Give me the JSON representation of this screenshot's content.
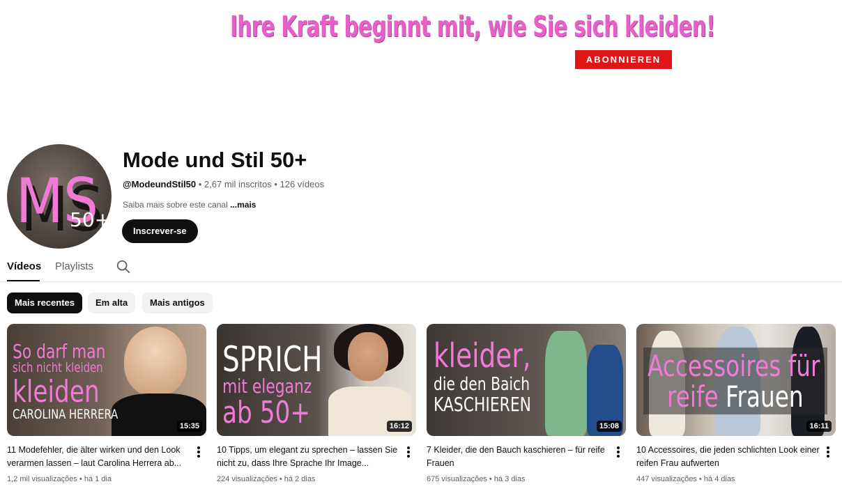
{
  "banner": {
    "slogan": "Ihre Kraft beginnt mit, wie Sie sich kleiden!",
    "subscribe_label": "ABONNIEREN"
  },
  "channel": {
    "avatar_text_main": "MS",
    "avatar_text_sub": "50+",
    "name": "Mode und Stil 50+",
    "handle": "@ModeundStil50",
    "meta_rest": " • 2,67 mil inscritos • 126 vídeos",
    "about_text": "Saiba mais sobre este canal ",
    "about_more": "...mais",
    "subscribe_button": "Inscrever-se"
  },
  "tabs": [
    {
      "label": "Vídeos",
      "active": true
    },
    {
      "label": "Playlists",
      "active": false
    }
  ],
  "tab_search_icon": "search-icon",
  "chips": [
    {
      "label": "Mais recentes",
      "active": true
    },
    {
      "label": "Em alta",
      "active": false
    },
    {
      "label": "Mais antigos",
      "active": false
    }
  ],
  "videos": [
    {
      "thumb_lines": [
        "So darf man",
        "sich nicht kleiden",
        "kleiden",
        "CAROLINA HERRERA"
      ],
      "duration": "15:35",
      "title": "11 Modefehler, die älter wirken und den Look verarmen lassen – laut Carolina Herrera ab...",
      "meta": "1,2 mil visualizações • há 1 dia"
    },
    {
      "thumb_lines": [
        "SPRICH",
        "mit eleganz",
        "ab 50+"
      ],
      "duration": "16:12",
      "title": "10 Tipps, um elegant zu sprechen – lassen Sie nicht zu, dass Ihre Sprache Ihr Image...",
      "meta": "224 visualizações • há 2 dias"
    },
    {
      "thumb_lines": [
        "kleider,",
        "die den Baich",
        "KASCHIEREN"
      ],
      "duration": "15:08",
      "title": "7 Kleider, die den Bauch kaschieren – für reife Frauen",
      "meta": "675 visualizações • há 3 dias"
    },
    {
      "thumb_lines": [
        "Accessoires für",
        "reife",
        "Frauen"
      ],
      "duration": "16:11",
      "title": "10 Accessoires, die jeden schlichten Look einer reifen Frau aufwerten",
      "meta": "447 visualizações • há 4 dias"
    }
  ],
  "colors": {
    "brand_pink": "#e85fc8",
    "subscribe_red": "#e01515",
    "text_primary": "#0f0f0f",
    "text_secondary": "#606060"
  }
}
